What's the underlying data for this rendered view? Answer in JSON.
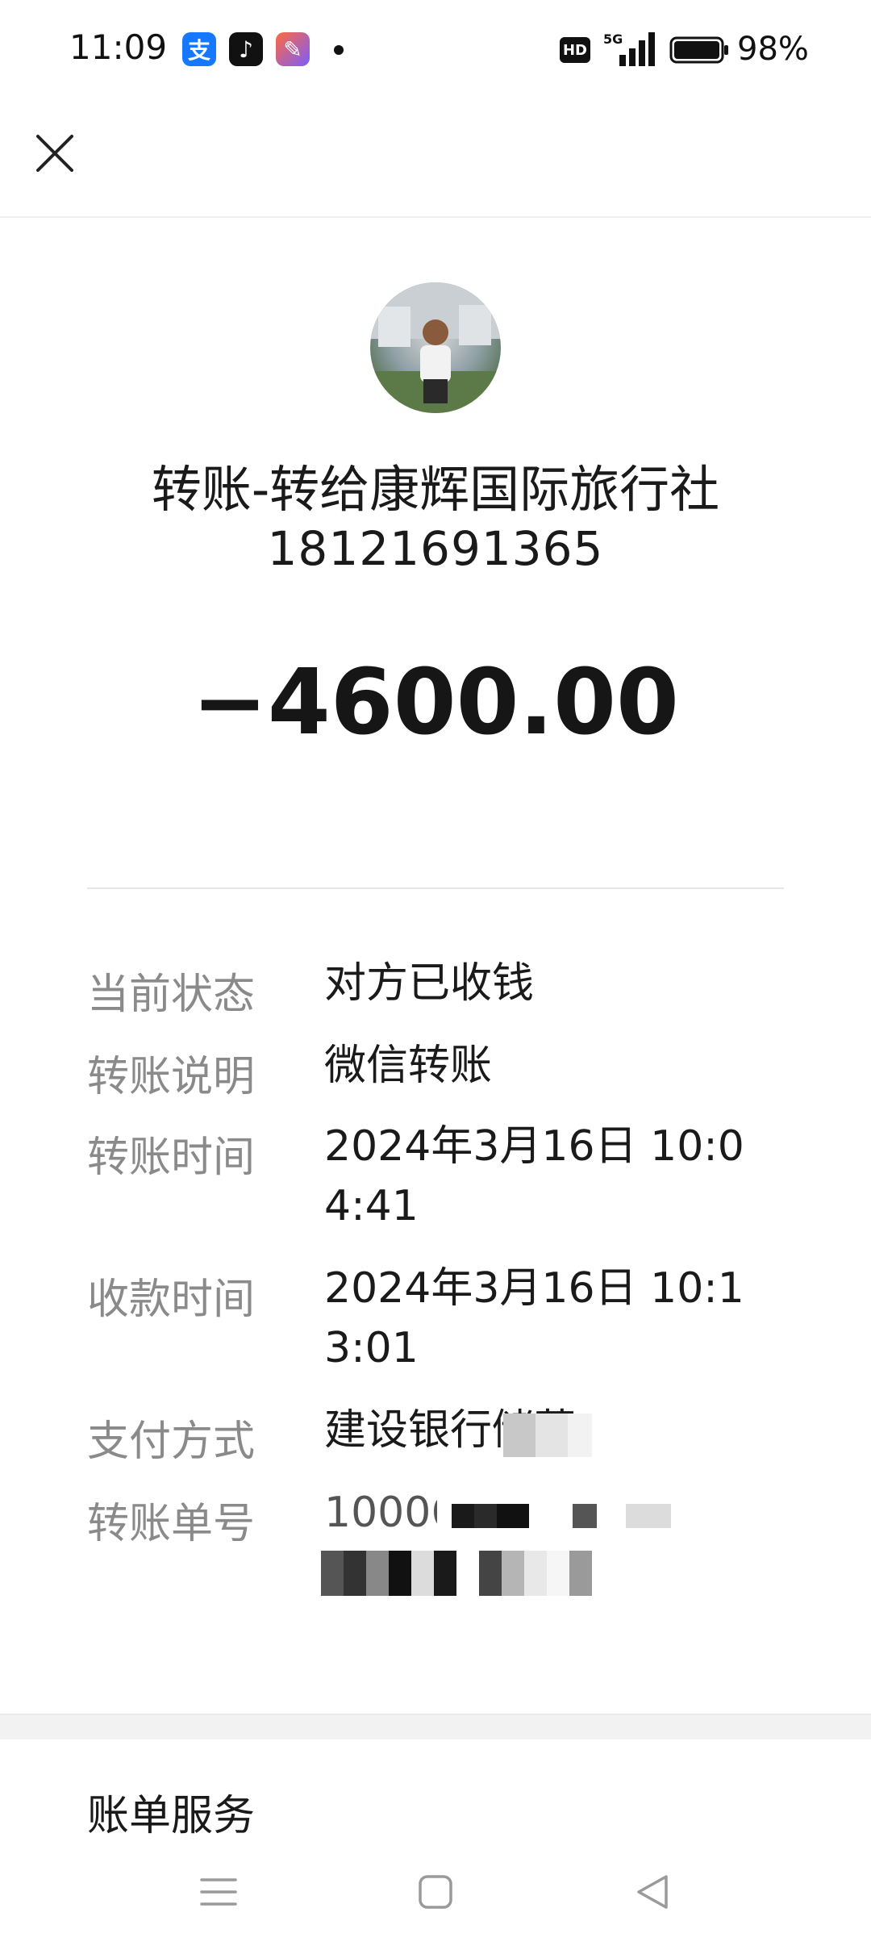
{
  "status_bar": {
    "time": "11:09",
    "battery": "98%",
    "network": "5G",
    "hd": "HD"
  },
  "header": {
    "title": "转账-转给康辉国际旅行社",
    "phone": "18121691365",
    "amount": "−4600.00"
  },
  "details": [
    {
      "label": "当前状态",
      "value": "对方已收钱"
    },
    {
      "label": "转账说明",
      "value": "微信转账"
    },
    {
      "label": "转账时间",
      "value": "2024年3月16日 10:04:41"
    },
    {
      "label": "收款时间",
      "value": "2024年3月16日 10:13:01"
    },
    {
      "label": "支付方式",
      "value": "建设银行储蓄"
    },
    {
      "label": "转账单号",
      "value": "10006"
    }
  ],
  "section": {
    "bill_service": "账单服务"
  },
  "icons": {
    "close": "close-icon",
    "menu": "menu-icon",
    "home": "home-icon",
    "back": "back-icon"
  }
}
